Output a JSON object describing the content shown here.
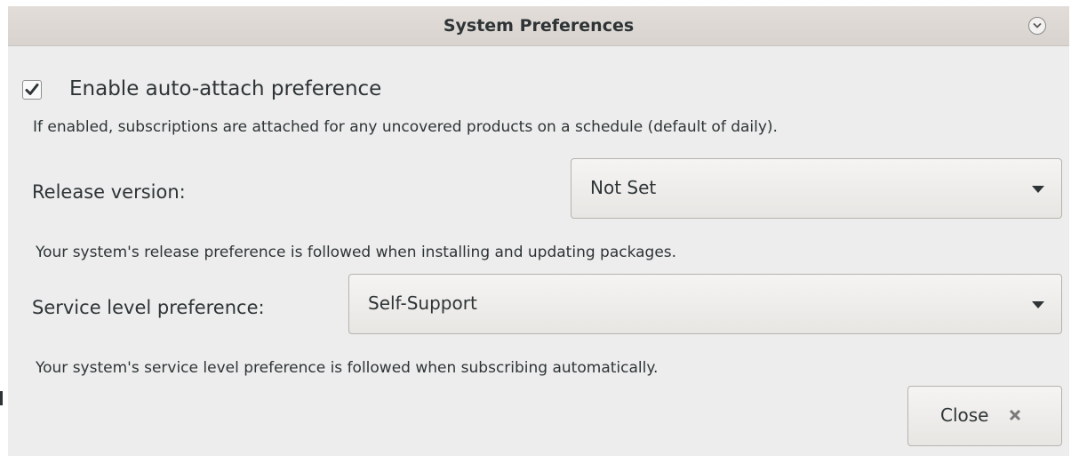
{
  "window": {
    "title": "System Preferences",
    "title_menu_icon": "chevron-down-circle-icon"
  },
  "auto_attach": {
    "checked": true,
    "label": "Enable auto-attach preference",
    "help": "If enabled, subscriptions are attached for any uncovered products on a schedule (default of daily)."
  },
  "release": {
    "label": "Release version:",
    "selected": "Not Set",
    "help": "Your system's release preference is followed when installing and updating packages."
  },
  "service_level": {
    "label": "Service level preference:",
    "selected": "Self-Support",
    "help": "Your system's service level preference is followed when subscribing automatically."
  },
  "close_button": {
    "label": "Close",
    "icon": "close-x-icon"
  },
  "colors": {
    "titlebar": "#dcd7d3",
    "window_bg": "#ededed",
    "text": "#2e3436"
  }
}
